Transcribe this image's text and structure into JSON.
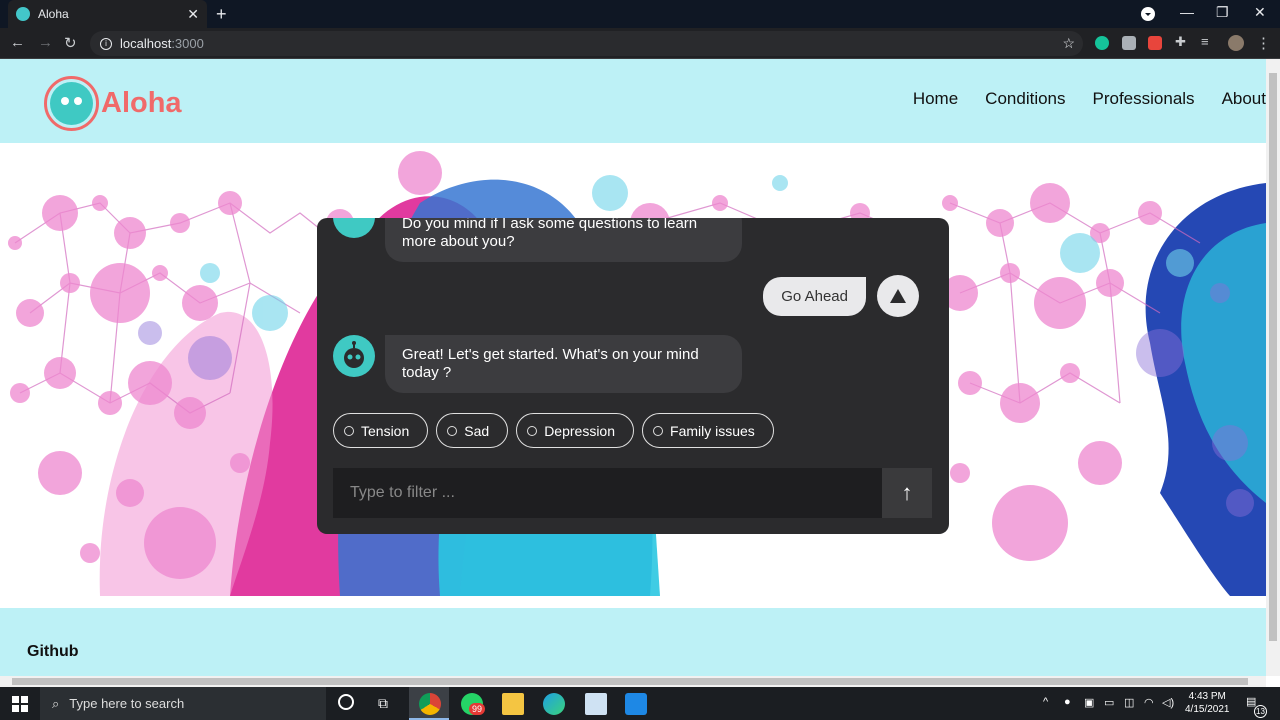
{
  "browser": {
    "tab_title": "Aloha",
    "url_host": "localhost",
    "url_port": ":3000"
  },
  "site": {
    "logo_text": "Aloha",
    "nav": [
      "Home",
      "Conditions",
      "Professionals",
      "About"
    ],
    "footer_link": "Github"
  },
  "chat": {
    "messages": [
      {
        "from": "bot",
        "text": "Do you mind if I ask some questions to learn more about you?"
      },
      {
        "from": "user",
        "text": "Go Ahead"
      },
      {
        "from": "bot",
        "text": "Great! Let's get started. What's on your mind today ?"
      }
    ],
    "options": [
      "Tension",
      "Sad",
      "Depression",
      "Family issues"
    ],
    "input_placeholder": "Type to filter ..."
  },
  "taskbar": {
    "search_placeholder": "Type here to search",
    "whatsapp_badge": "99",
    "time": "4:43 PM",
    "date": "4/15/2021",
    "notification_count": "13"
  },
  "colors": {
    "header_bg": "#bdf1f6",
    "brand": "#f06a6a",
    "bot_avatar": "#3fc9c3",
    "chat_bg": "#2b2b2d"
  }
}
